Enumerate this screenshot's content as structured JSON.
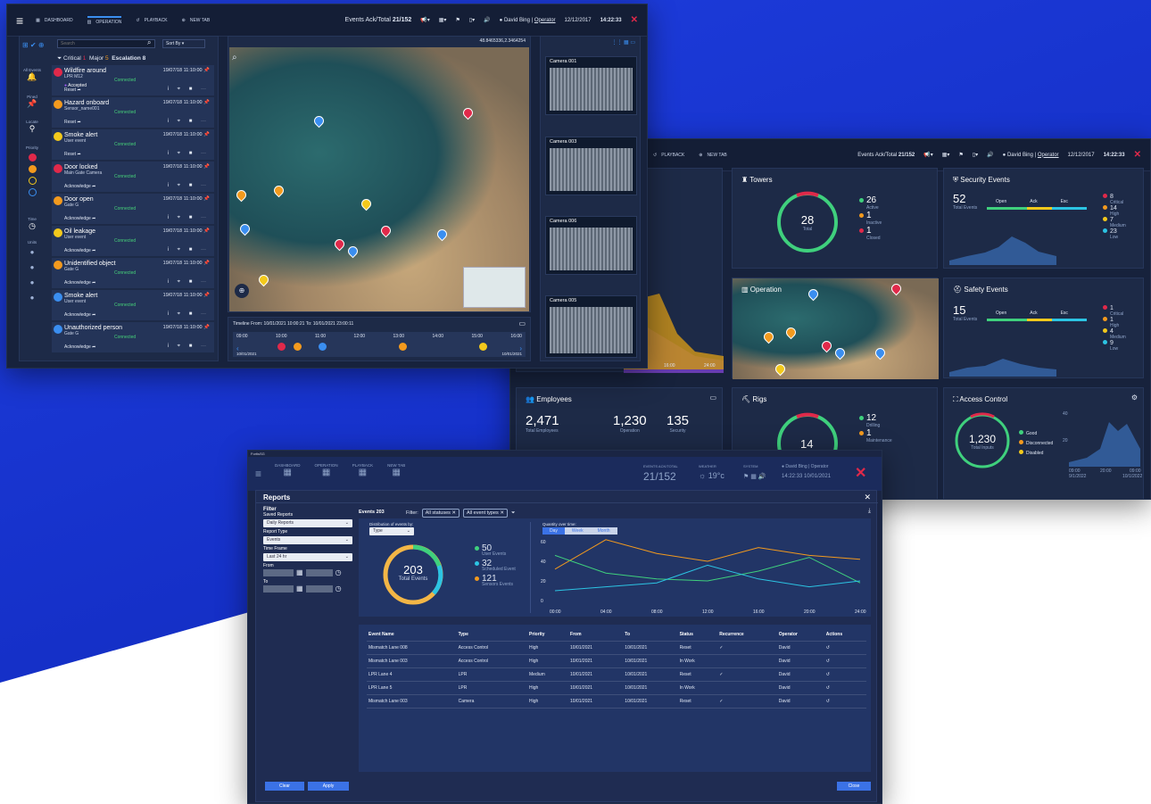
{
  "colors": {
    "red": "#e0294a",
    "orange": "#f39a1e",
    "yellow": "#f3c91c",
    "blue": "#3a8ef0",
    "green": "#3fd07d",
    "cyan": "#2cc4e3"
  },
  "nav": {
    "dashboard": "DASHBOARD",
    "operation": "OPERATION",
    "playback": "PLAYBACK",
    "new_tab": "NEW TAB"
  },
  "header": {
    "events_label": "Events Ack/Total",
    "events_value": "21/152",
    "user": "David Bing | ",
    "role": "Operator",
    "date": "12/12/2017",
    "time": "14:22:33",
    "brand": "FORTIS"
  },
  "op": {
    "search_placeholder": "Search",
    "sort": "Sort By",
    "critical": "Critical",
    "critical_n": "1",
    "major": "Major",
    "major_n": "5",
    "escalation": "Escalation 8",
    "rail": [
      "All Events",
      "Pined",
      "Locate",
      "Priority",
      "Time",
      "Units"
    ],
    "events": [
      {
        "title": "Wildfire around",
        "date": "19/07/18 11:10:00",
        "sub": "LPR M12",
        "state": "Connected",
        "tag": "Accepted",
        "action": "Reset",
        "color": "#e0294a"
      },
      {
        "title": "Hazard onboard",
        "date": "19/07/18 11:10:00",
        "sub": "Sensor_name001",
        "state": "Connected",
        "action": "Reset",
        "color": "#f39a1e"
      },
      {
        "title": "Smoke alert",
        "date": "19/07/18 11:10:00",
        "sub": "User event",
        "state": "Connected",
        "action": "Reset",
        "color": "#f3c91c"
      },
      {
        "title": "Door locked",
        "date": "19/07/18 11:10:00",
        "sub": "Main Gate Camera",
        "state": "Connected",
        "action": "Acknowledge",
        "color": "#e0294a"
      },
      {
        "title": "Door open",
        "date": "19/07/18 11:10:00",
        "sub": "Gate G",
        "state": "Connected",
        "action": "Acknowledge",
        "color": "#f39a1e"
      },
      {
        "title": "Oil leakage",
        "date": "19/07/18 11:10:00",
        "sub": "User event",
        "state": "Connected",
        "action": "Acknowledge",
        "color": "#f3c91c"
      },
      {
        "title": "Unidentified object",
        "date": "19/07/18 11:10:00",
        "sub": "Gate G",
        "state": "Connected",
        "action": "Acknowledge",
        "color": "#f39a1e"
      },
      {
        "title": "Smoke alert",
        "date": "19/07/18 11:10:00",
        "sub": "User event",
        "state": "Connected",
        "action": "Acknowledge",
        "color": "#3a8ef0"
      },
      {
        "title": "Unauthorized person",
        "date": "19/07/18 11:10:00",
        "sub": "Gate G",
        "state": "Connected",
        "action": "Acknowledge",
        "color": "#3a8ef0"
      }
    ],
    "coords": "48.8465336,2.3464254",
    "timeline": "Timeline From: 10/01/2021 10:00:21 To: 10/01/2021 23:00:11",
    "timeline_ticks": [
      "09:00",
      "10:00",
      "11:00",
      "12:00",
      "13:00",
      "14:00",
      "15:00",
      "16:00"
    ],
    "timeline_dates": [
      "10/01/2021",
      "10/01/2021"
    ],
    "cameras": [
      "Camera 001",
      "Camera 003",
      "Camera 006",
      "Camera 005"
    ]
  },
  "dash": {
    "towers": {
      "title": "Towers",
      "total": "28",
      "total_label": "Total",
      "active": "26",
      "active_l": "Active",
      "inactive": "1",
      "inactive_l": "Inactive",
      "closed": "1",
      "closed_l": "Closed"
    },
    "security": {
      "title": "Security Events",
      "total": "52",
      "total_label": "Total Events",
      "open": "Open",
      "ack": "Ack",
      "esc": "Esc",
      "critical": "8",
      "critical_l": "Critical",
      "high": "14",
      "high_l": "High",
      "medium": "7",
      "medium_l": "Medium",
      "low": "23",
      "low_l": "Low"
    },
    "operation": {
      "title": "Operation"
    },
    "safety": {
      "title": "Safety Events",
      "total": "15",
      "total_label": "Total Events",
      "open": "Open",
      "ack": "Ack",
      "esc": "Esc",
      "critical": "1",
      "critical_l": "Critical",
      "high": "1",
      "high_l": "High",
      "medium": "4",
      "medium_l": "Medium",
      "low": "9",
      "low_l": "Low"
    },
    "employees": {
      "title": "Employees",
      "total": "2,471",
      "total_l": "Total Employees",
      "op": "1,230",
      "op_l": "Operation",
      "sec": "135",
      "sec_l": "Security"
    },
    "rigs": {
      "title": "Rigs",
      "total": "14",
      "drilling": "12",
      "drilling_l": "Drilling",
      "maint": "1",
      "maint_l": "Maintenance"
    },
    "access": {
      "title": "Access Control",
      "total": "1,230",
      "total_l": "Total Inputs",
      "good": "Good",
      "disc": "Disconnected",
      "dis": "Disabled",
      "y40": "40",
      "y20": "20",
      "t1": "09:00",
      "t2": "20:00",
      "t3": "09:00",
      "d1": "9/1/2022",
      "d2": "10/1/2022"
    },
    "area_ticks": [
      "16:00",
      "24:00"
    ]
  },
  "rep": {
    "app": "FortisSG",
    "hdr_nav": [
      "DASHBOARD",
      "OPERATION",
      "PLAYBACK",
      "NEW TAB"
    ],
    "events_ack_label": "EVENTS ACK/TOTAL",
    "events_ack": "21/152",
    "weather_label": "WEATHER",
    "weather": "19°c",
    "system": "SYSTEM",
    "user": "David Bing | Operator",
    "time": "14:22:33",
    "date": "10/01/2021",
    "brand": "FORTIS",
    "title": "Reports",
    "filter": "Filter",
    "saved_reports": "Saved Reports",
    "saved_value": "Daily Reports",
    "report_type": "Report Type",
    "report_value": "Events",
    "time_range": "Time Frame",
    "time_value": "Last 24 hr",
    "from": "From",
    "to": "To",
    "events_count": "Events 203",
    "filter_lbl": "Filter:",
    "chip1": "All statuses",
    "chip2": "All event types",
    "dist_title": "Distribution of events by:",
    "dist_sel": "Type",
    "total": "203",
    "total_l": "Total Events",
    "user_events": "50",
    "user_events_l": "User Events",
    "sched": "32",
    "sched_l": "Scheduled Event",
    "sensor": "121",
    "sensor_l": "Sensors Events",
    "qty_title": "Quantity over time:",
    "tabs": [
      "Day",
      "Week",
      "Month"
    ],
    "cols": [
      "Event Name",
      "Type",
      "Priority",
      "From",
      "To",
      "Status",
      "Recurrence",
      "Operator",
      "Actions"
    ],
    "rows": [
      [
        "Mismatch Lane 008",
        "Access Control",
        "High",
        "10/01/2021",
        "10/01/2021",
        "Reset",
        "✓",
        "David",
        "↺"
      ],
      [
        "Mismatch Lane 003",
        "Access Control",
        "High",
        "10/01/2021",
        "10/01/2021",
        "In Work",
        "",
        "David",
        "↺"
      ],
      [
        "LPR Lane 4",
        "LPR",
        "Medium",
        "10/01/2021",
        "10/01/2021",
        "Reset",
        "✓",
        "David",
        "↺"
      ],
      [
        "LPR Lane 5",
        "LPR",
        "High",
        "10/01/2021",
        "10/01/2021",
        "In Work",
        "",
        "David",
        "↺"
      ],
      [
        "Mismatch Lane 003",
        "Camera",
        "High",
        "10/01/2021",
        "10/01/2021",
        "Reset",
        "✓",
        "David",
        "↺"
      ]
    ],
    "clear": "Clear",
    "apply": "Apply",
    "close": "Close",
    "chart_data": {
      "type": "line",
      "x": [
        "00:00",
        "04:00",
        "08:00",
        "12:00",
        "16:00",
        "20:00",
        "24:00"
      ],
      "ylim": [
        0,
        60
      ],
      "yticks": [
        "60",
        "40",
        "20",
        "0"
      ],
      "series": [
        {
          "color": "#f39a1e",
          "values": [
            32,
            62,
            48,
            40,
            54,
            46,
            42
          ]
        },
        {
          "color": "#3fd07d",
          "values": [
            46,
            28,
            22,
            20,
            30,
            44,
            18
          ]
        },
        {
          "color": "#2cc4e3",
          "values": [
            10,
            14,
            18,
            36,
            22,
            14,
            20
          ]
        }
      ]
    }
  }
}
